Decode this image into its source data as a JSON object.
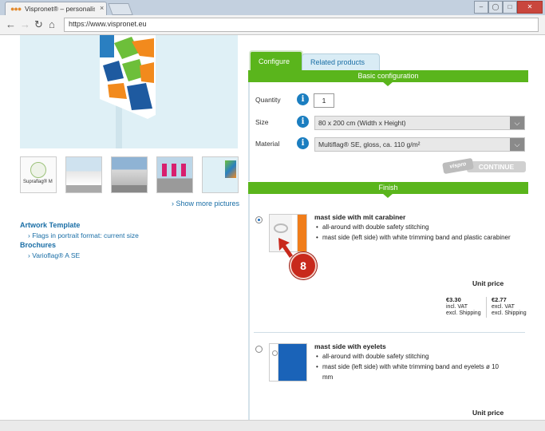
{
  "browser": {
    "tab_title": "Vispronet® – personalise",
    "tab_close": "×",
    "url": "https://www.vispronet.eu",
    "controls": {
      "minimize": "–",
      "restore": "□",
      "close": "✕"
    }
  },
  "gallery": {
    "thumbs": [
      {
        "label": "Supraflag® M"
      },
      {
        "label": ""
      },
      {
        "label": ""
      },
      {
        "label": ""
      },
      {
        "label": ""
      }
    ],
    "show_more": "› Show more pictures"
  },
  "left": {
    "artwork_heading": "Artwork Template",
    "artwork_link": "› Flags in portrait format: current size",
    "brochures_heading": "Brochures",
    "brochure_link": "› Varioflag® A SE"
  },
  "tabs": [
    {
      "label": "Configure",
      "active": true
    },
    {
      "label": "Related products",
      "active": false
    }
  ],
  "basic": {
    "header": "Basic configuration",
    "quantity_label": "Quantity",
    "quantity_value": "1",
    "size_label": "Size",
    "size_value": "80 x 200 cm (Width x Height)",
    "material_label": "Material",
    "material_value": "Multiflag® SE, gloss, ca. 110 g/m²",
    "continue_logo": "vispro",
    "continue_label": "CONTINUE",
    "info_glyph": "i",
    "dropdown_glyph": "⌵"
  },
  "finish": {
    "header": "Finish",
    "options": [
      {
        "title": "mast side with mit carabiner",
        "bullets": [
          "all-around with double safety stitching",
          "mast side (left side) with white trimming band and plastic carabiner"
        ],
        "selected": true,
        "unit_price_label": "Unit price",
        "price_incl": "€3.30",
        "incl_line1": "incl. VAT",
        "incl_line2": "excl. Shipping",
        "price_excl": "€2.77",
        "excl_line1": "excl. VAT",
        "excl_line2": "excl. Shipping"
      },
      {
        "title": "mast side with eyelets",
        "bullets": [
          "all-around with double safety stitching",
          "mast side (left side) with white trimming band and eyelets ø 10 mm"
        ],
        "selected": false,
        "unit_price_label": "Unit price"
      }
    ]
  },
  "annotation": {
    "step": "8"
  },
  "colors": {
    "accent_green": "#5ab51c",
    "info_blue": "#1b7ec0",
    "badge_red": "#c8291c",
    "link_blue": "#1a6ea6"
  }
}
